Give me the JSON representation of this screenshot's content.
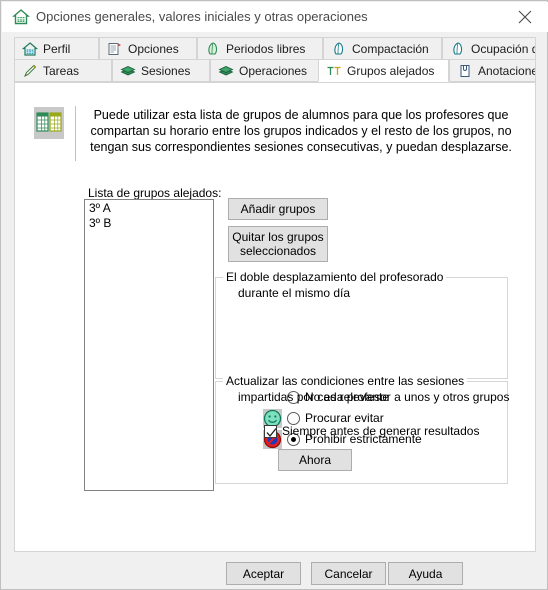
{
  "window": {
    "title": "Opciones generales, valores iniciales y otras operaciones",
    "title_icon": "house-icon",
    "close_icon": "close-icon"
  },
  "tabs": {
    "row1": [
      {
        "label": "Perfil",
        "icon": "house-icon",
        "selected": false
      },
      {
        "label": "Opciones",
        "icon": "clipboard-icon",
        "selected": false
      },
      {
        "label": "Periodos libres",
        "icon": "leaf-icon",
        "selected": false
      },
      {
        "label": "Compactación",
        "icon": "leaf-icon",
        "selected": false
      },
      {
        "label": "Ocupación diaria",
        "icon": "leaf-icon",
        "selected": false
      }
    ],
    "row2": [
      {
        "label": "Tareas",
        "icon": "pencil-icon",
        "selected": false
      },
      {
        "label": "Sesiones",
        "icon": "books-icon",
        "selected": false
      },
      {
        "label": "Operaciones",
        "icon": "books-icon",
        "selected": false
      },
      {
        "label": "Grupos alejados",
        "icon": "double-t-icon",
        "selected": true
      },
      {
        "label": "Anotaciones",
        "icon": "clip-note-icon",
        "selected": false
      }
    ]
  },
  "panel": {
    "info_icon": "spreadsheet-icon",
    "info_text": "Puede utilizar esta lista de grupos de alumnos para que los profesores que compartan su horario entre los grupos indicados y el resto de los grupos, no tengan sus correspondientes sesiones consecutivas, y puedan desplazarse.",
    "list_label": "Lista de grupos alejados:",
    "list_items": [
      "3º A",
      "3º B"
    ],
    "add_button": "Añadir grupos",
    "remove_button": "Quitar los grupos seleccionados",
    "group_double_move": {
      "title": "El doble desplazamiento del profesorado",
      "subtitle": "durante el mismo día",
      "options": [
        {
          "label": "No es relevante",
          "selected": false,
          "icon": null
        },
        {
          "label": "Procurar evitar",
          "selected": false,
          "icon": "green-smiley-icon"
        },
        {
          "label": "Prohibir estrictamente",
          "selected": true,
          "icon": "no-entry-icon"
        }
      ]
    },
    "group_update": {
      "title": "Actualizar las condiciones entre las sesiones",
      "subtitle": "impartidas por cada profesor a unos y otros grupos",
      "checkbox_label": "Siempre antes de generar resultados",
      "checkbox_checked": true,
      "now_button": "Ahora"
    }
  },
  "footer": {
    "accept": "Aceptar",
    "cancel": "Cancelar",
    "help": "Ayuda"
  },
  "colors": {
    "accent_green": "#2e8b57",
    "window_bg": "#f0f0f0",
    "panel_bg": "#ffffff",
    "button_bg": "#e1e1e1"
  }
}
